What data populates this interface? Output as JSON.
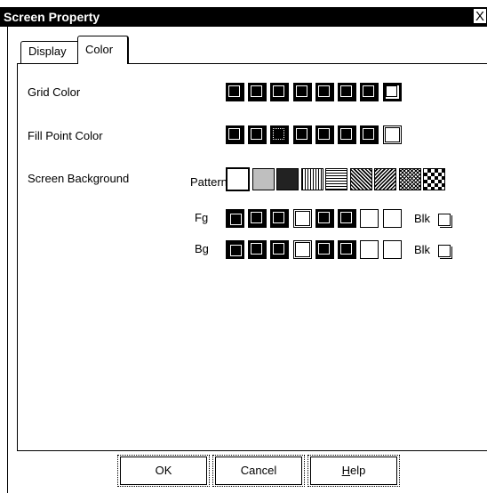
{
  "window": {
    "title": "Screen Property",
    "close_label": "X"
  },
  "tabs": [
    {
      "label": "Display"
    },
    {
      "label": "Color"
    }
  ],
  "grid_color": {
    "label": "Grid Color",
    "selected_index": 7
  },
  "fill_point_color": {
    "label": "Fill Point Color",
    "selected_index": 2
  },
  "screen_background": {
    "label": "Screen Background",
    "pattern_label": "Pattern",
    "selected_pattern_index": 0,
    "fg_label": "Fg",
    "bg_label": "Bg",
    "fg_blink_label": "Blk",
    "bg_blink_label": "Blk"
  },
  "buttons": {
    "ok": "OK",
    "cancel": "Cancel",
    "help": "Help"
  },
  "colors": {
    "swatch_dark": "#000000",
    "swatch_light": "#ffffff"
  }
}
